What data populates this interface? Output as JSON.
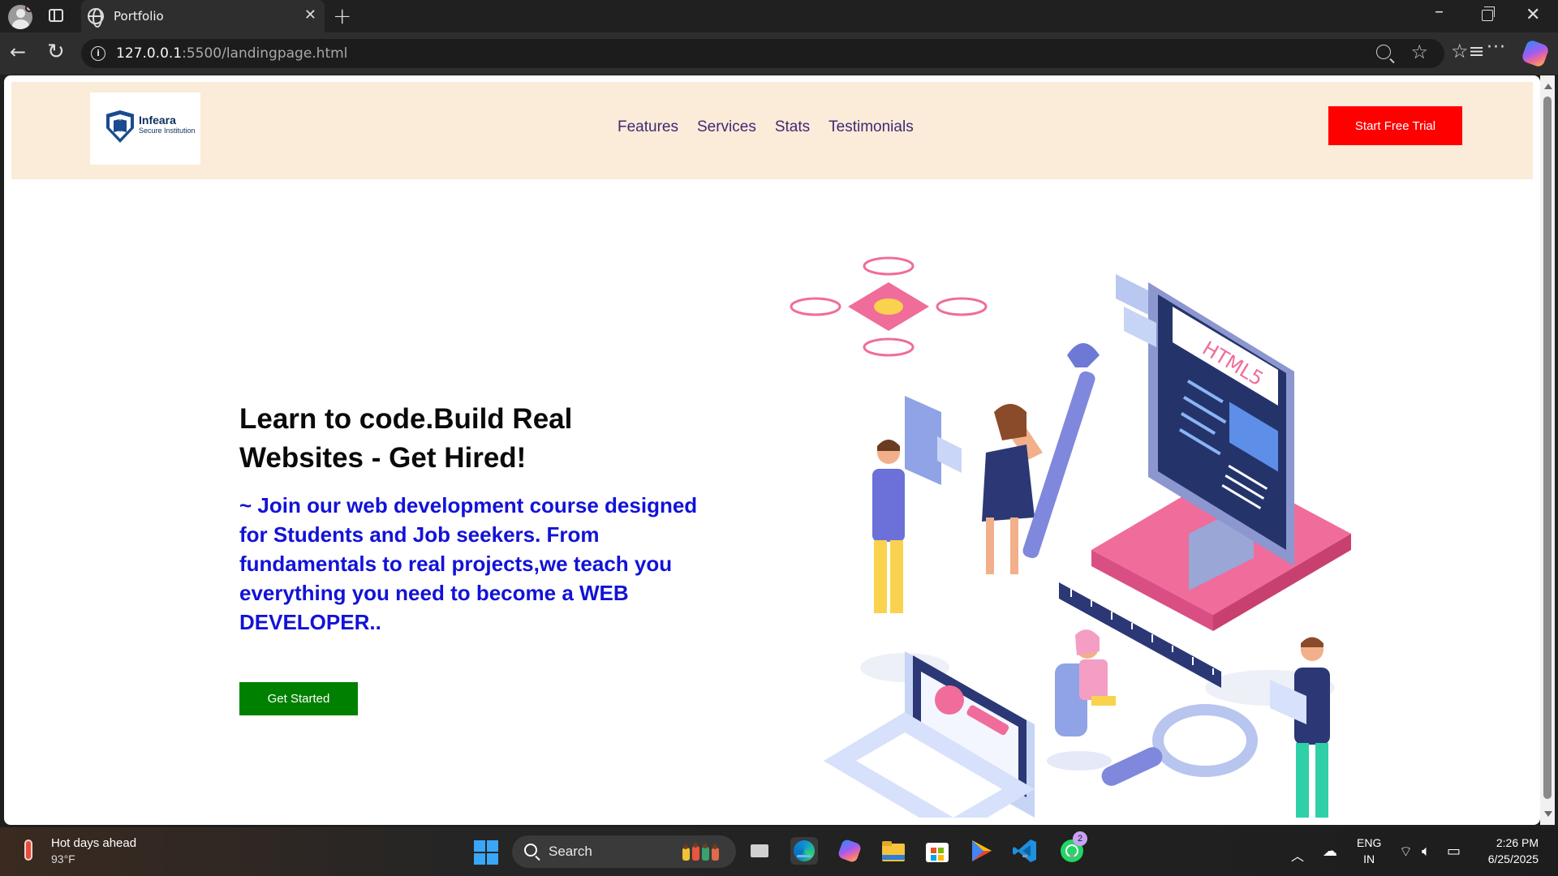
{
  "browser": {
    "tab_title": "Portfolio",
    "close_symbol": "✕",
    "new_tab_symbol": "+",
    "url_host": "127.0.0.1",
    "url_path": ":5500/landingpage.html",
    "icons": [
      "profile-icon",
      "tab-actions-icon",
      "globe-icon",
      "back-icon",
      "reload-icon",
      "info-icon",
      "zoom-out-icon",
      "favorite-star-icon",
      "favorites-icon",
      "more-icon",
      "copilot-icon"
    ]
  },
  "site": {
    "logo": {
      "name": "Infeara",
      "tagline": "Secure Institution"
    },
    "nav": [
      "Features",
      "Services",
      "Stats",
      "Testimonials"
    ],
    "cta_label": "Start Free Trial",
    "hero": {
      "title": "Learn to code.Build Real Websites - Get Hired!",
      "text": "~ Join our web development course designed for Students and Job seekers. From fundamentals to real projects,we teach you everything you need to become a WEB DEVELOPER..",
      "button_label": "Get Started"
    },
    "illustration_text": "HTML5",
    "colors": {
      "header_bg": "#fbebd9",
      "cta": "#ff0000",
      "hero_text": "#1212d8",
      "get_started": "#008000",
      "nav_text": "#3f2a74"
    }
  },
  "taskbar": {
    "weather_title": "Hot days ahead",
    "weather_temp": "93°F",
    "search_label": "Search",
    "whatsapp_badge": "2",
    "lang_line1": "ENG",
    "lang_line2": "IN",
    "time": "2:26 PM",
    "date": "6/25/2025",
    "apps": [
      "windows-start-icon",
      "task-view-icon",
      "edge-icon",
      "copilot-app-icon",
      "file-explorer-icon",
      "microsoft-store-icon",
      "play-store-icon",
      "vscode-icon",
      "whatsapp-icon"
    ]
  }
}
